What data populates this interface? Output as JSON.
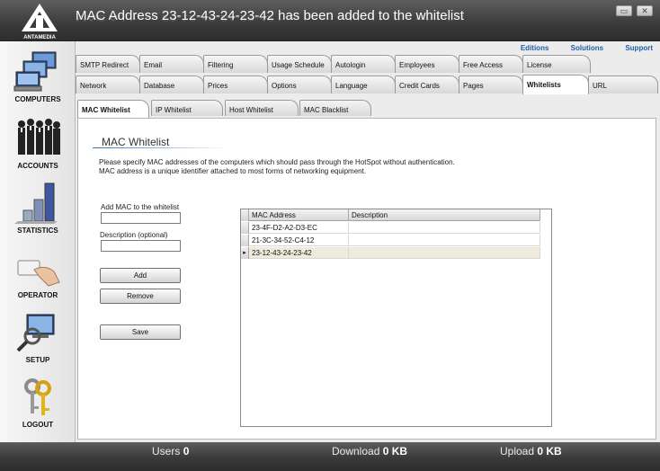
{
  "window": {
    "title": "MAC Address 23-12-43-24-23-42 has been added to the whitelist",
    "logo_text": "ANTAMEDIA",
    "minimize_icon": "minimize-icon",
    "close_label": "✕"
  },
  "sidebar": {
    "items": [
      {
        "label": "COMPUTERS",
        "icon": "computers-icon"
      },
      {
        "label": "ACCOUNTS",
        "icon": "accounts-icon"
      },
      {
        "label": "STATISTICS",
        "icon": "statistics-icon"
      },
      {
        "label": "OPERATOR",
        "icon": "operator-icon"
      },
      {
        "label": "SETUP",
        "icon": "setup-icon"
      },
      {
        "label": "LOGOUT",
        "icon": "logout-icon"
      }
    ]
  },
  "toplinks": {
    "editions": "Editions",
    "solutions": "Solutions",
    "support": "Support"
  },
  "tabs_row1": [
    "SMTP Redirect",
    "Email",
    "Filtering",
    "Usage Schedule",
    "Autologin",
    "Employees",
    "Free Access",
    "License"
  ],
  "tabs_row2": [
    "Network",
    "Database",
    "Prices",
    "Options",
    "Language",
    "Credit Cards",
    "Pages",
    "Whitelists",
    "URL"
  ],
  "active_tab": "Whitelists",
  "subtabs": [
    "MAC Whitelist",
    "IP Whitelist",
    "Host Whitelist",
    "MAC Blacklist"
  ],
  "active_subtab": "MAC Whitelist",
  "panel": {
    "heading": "MAC Whitelist",
    "desc_line1": "Please specify MAC addresses of the computers which should pass through the HotSpot without authentication.",
    "desc_line2": "MAC address is a unique identifier attached to most forms of networking equipment.",
    "add_mac_label": "Add MAC to the whitelist",
    "add_mac_value": "",
    "description_label": "Description (optional)",
    "description_value": "",
    "add_button": "Add",
    "remove_button": "Remove",
    "save_button": "Save"
  },
  "grid": {
    "columns": [
      "MAC Address",
      "Description"
    ],
    "rows": [
      {
        "mac": "23-4F-D2-A2-D3-EC",
        "description": ""
      },
      {
        "mac": "21-3C-34-52-C4-12",
        "description": ""
      },
      {
        "mac": "23-12-43-24-23-42",
        "description": ""
      }
    ],
    "selected_row_marker": "▸"
  },
  "status": {
    "users_label": "Users",
    "users_value": "0",
    "download_label": "Download",
    "download_value": "0 KB",
    "upload_label": "Upload",
    "upload_value": "0 KB"
  }
}
